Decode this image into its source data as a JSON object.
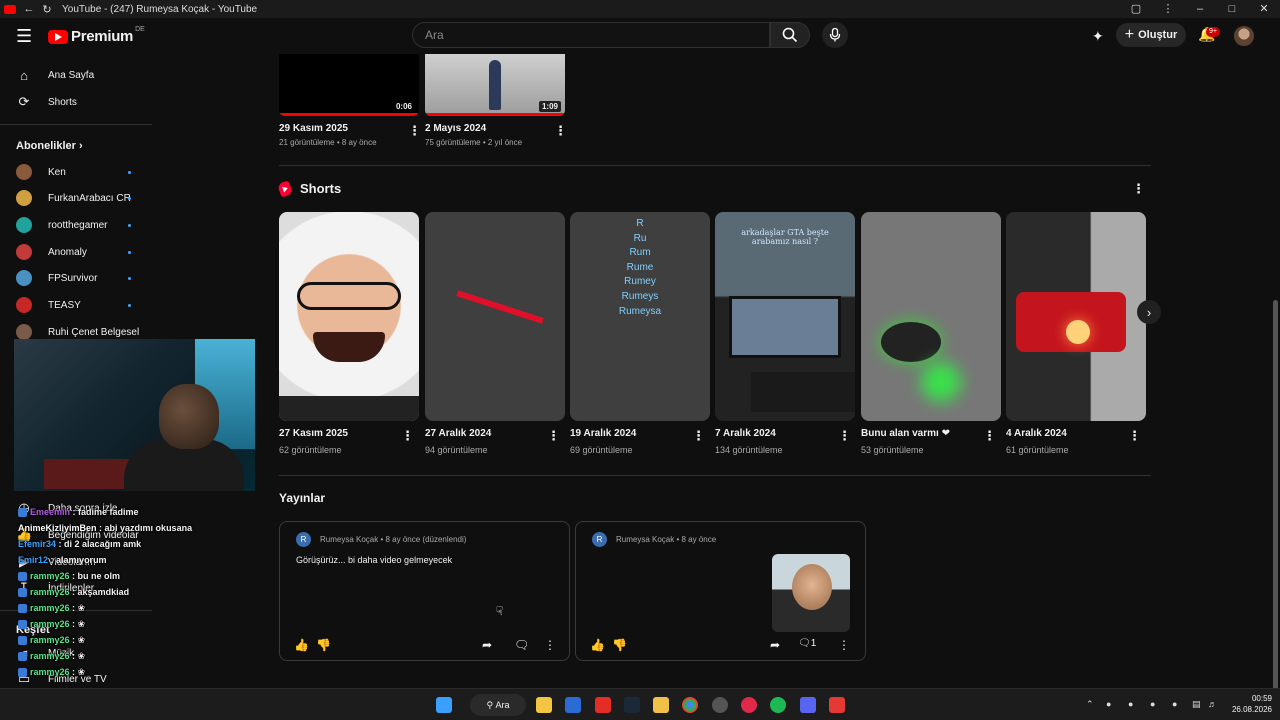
{
  "window": {
    "title": "YouTube - (247) Rumeysa Koçak - YouTube",
    "buttons": [
      "–",
      "□",
      "✕"
    ]
  },
  "masthead": {
    "logo": "Premium",
    "country": "DE",
    "search_placeholder": "Ara",
    "create_label": "Oluştur",
    "notification_badge": "9+"
  },
  "sidebar": {
    "items": [
      {
        "label": "Ana Sayfa",
        "icon": "home-icon"
      },
      {
        "label": "Shorts",
        "icon": "shorts-icon"
      }
    ],
    "subscriptions_title": "Abonelikler",
    "subscriptions": [
      {
        "label": "Ken",
        "color": "#8a5a3c"
      },
      {
        "label": "FurkanArabacı CR",
        "color": "#d0a040"
      },
      {
        "label": "rootthegamer",
        "color": "#1fa39b"
      },
      {
        "label": "Anomaly",
        "color": "#c23a3a"
      },
      {
        "label": "FPSurvivor",
        "color": "#4a90c2"
      },
      {
        "label": "TEASY",
        "color": "#c62828"
      },
      {
        "label": "Ruhi Çenet Belgesel",
        "color": "#7a5a48"
      }
    ],
    "more_items": [
      {
        "label": "Daha sonra izle"
      },
      {
        "label": "Beğendiğim videolar"
      },
      {
        "label": "Videolarım"
      },
      {
        "label": "İndirilenler"
      }
    ],
    "explore_title": "Keşfet",
    "explore_items": [
      {
        "label": "Müzik"
      },
      {
        "label": "Filmler ve TV"
      }
    ]
  },
  "chat": [
    {
      "user": "Emeemin",
      "text": ": fadime fadime",
      "color": "#b05be0"
    },
    {
      "user": "AnimeKizliyimBen",
      "text": ": abi yazdımı okusana",
      "color": "#ffffff"
    },
    {
      "user": "Efemir34",
      "text": ": di 2 alacağım amk",
      "color": "#3aa0ff"
    },
    {
      "user": "Emir12",
      "text": ": alamıyorum",
      "color": "#3aa0ff"
    },
    {
      "user": "rammy26",
      "text": ": bu ne olm",
      "color": "#5be38a"
    },
    {
      "user": "rammy26",
      "text": ": akşamdkiad",
      "color": "#5be38a"
    },
    {
      "user": "rammy26",
      "text": ": ❀",
      "color": "#5be38a"
    },
    {
      "user": "rammy26",
      "text": ": ❀",
      "color": "#5be38a"
    },
    {
      "user": "rammy26",
      "text": ": ❀",
      "color": "#5be38a"
    },
    {
      "user": "rammy26",
      "text": ": ❀",
      "color": "#5be38a"
    },
    {
      "user": "rammy26",
      "text": ": ❀",
      "color": "#5be38a"
    }
  ],
  "videos": [
    {
      "title": "29 Kasım 2025",
      "meta": "21 görüntüleme • 8 ay önce",
      "duration": "0:06"
    },
    {
      "title": "2 Mayıs 2024",
      "meta": "75 görüntüleme • 2 yıl önce",
      "duration": "1:09"
    }
  ],
  "shorts": {
    "title": "Shorts",
    "items": [
      {
        "title": "27 Kasım 2025",
        "views": "62 görüntüleme"
      },
      {
        "title": "27 Aralık 2024",
        "views": "94 görüntüleme"
      },
      {
        "title": "19 Aralık 2024",
        "views": "69 görüntüleme",
        "overlay": [
          "R",
          "Ru",
          "Rum",
          "Rume",
          "Rumey",
          "Rumeys",
          "Rumeysa"
        ]
      },
      {
        "title": "7 Aralık 2024",
        "views": "134 görüntüleme",
        "overlay_text": "arkadaşlar GTA beşte arabamız nasıl ?"
      },
      {
        "title": "Bunu alan varmı ❤",
        "views": "53 görüntüleme"
      },
      {
        "title": "4 Aralık 2024",
        "views": "61 görüntüleme"
      }
    ]
  },
  "posts": {
    "title": "Yayınlar",
    "items": [
      {
        "avatar": "R",
        "author": "Rumeysa Koçak",
        "time": "8 ay önce (düzenlendi)",
        "text": "Görüşürüz... bi daha video gelmeyecek",
        "comments": ""
      },
      {
        "avatar": "R",
        "author": "Rumeysa Koçak",
        "time": "8 ay önce",
        "text": "",
        "comments": "1"
      }
    ]
  },
  "taskbar": {
    "search_label": "Ara",
    "time": "00:59",
    "date": "26.08.2026"
  }
}
